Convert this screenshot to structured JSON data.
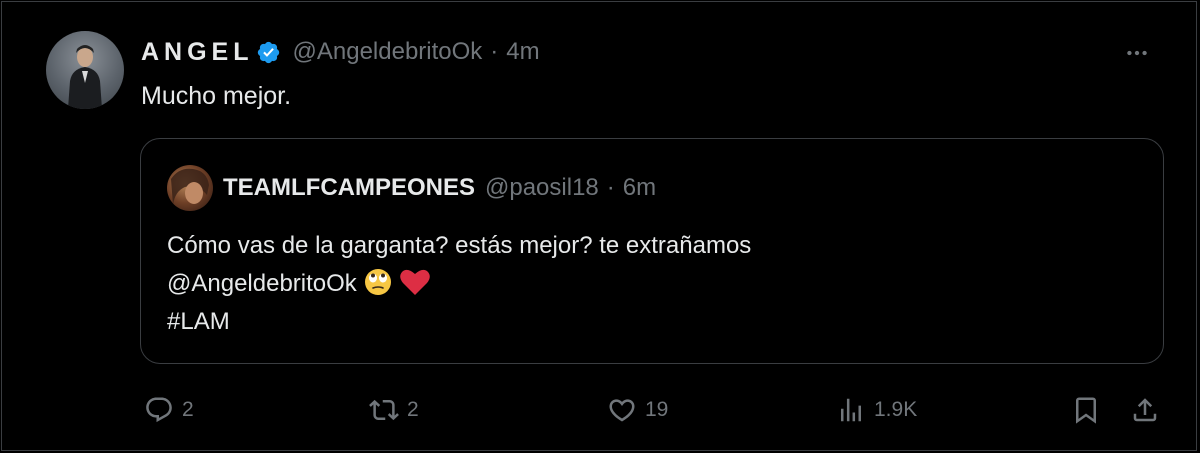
{
  "tweet": {
    "author_name": "ANGEL",
    "author_handle": "@AngeldebritoOk",
    "time": "4m",
    "text": "Mucho mejor."
  },
  "quoted": {
    "author_name": "TEAMLFCAMPEONES",
    "author_handle": "@paosil18",
    "time": "6m",
    "line1": "Cómo vas de la garganta? estás mejor? te extrañamos",
    "line2": "@AngeldebritoOk",
    "line3": "#LAM"
  },
  "actions": {
    "replies": "2",
    "reposts": "2",
    "likes": "19",
    "views": "1.9K"
  },
  "icons": {
    "verified": "verified-badge-icon",
    "more": "more-icon",
    "reply": "reply-icon",
    "repost": "repost-icon",
    "like": "heart-icon",
    "views": "views-icon",
    "bookmark": "bookmark-icon",
    "share": "share-icon",
    "emoji1": "face-with-rolling-eyes-icon",
    "emoji2": "red-heart-icon"
  },
  "colors": {
    "background": "#000000",
    "text": "#e7e9ea",
    "muted": "#71767b",
    "verified": "#1d9bf0",
    "border": "#3a3d41"
  }
}
